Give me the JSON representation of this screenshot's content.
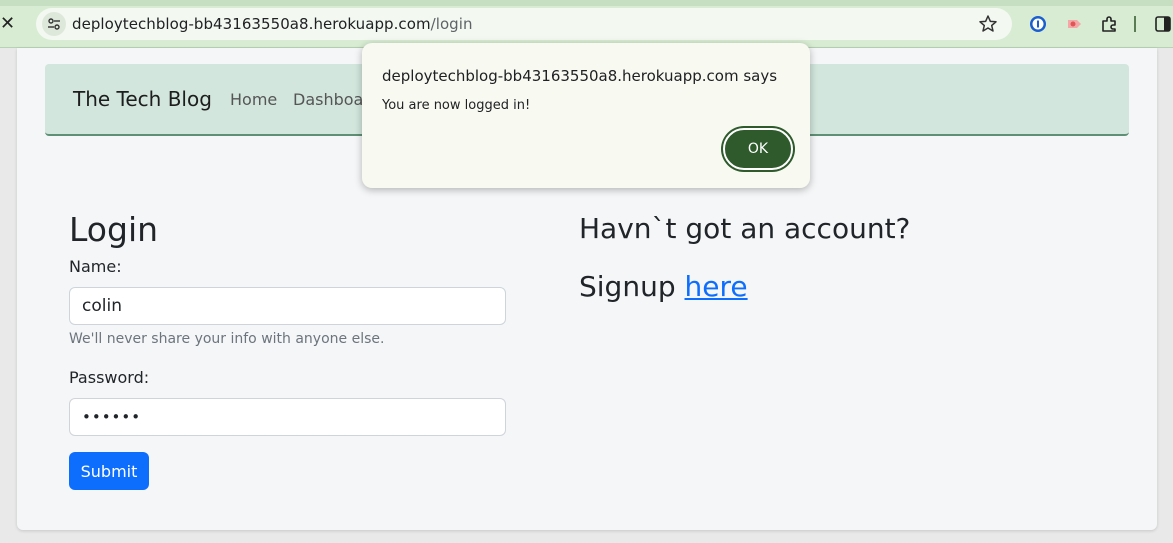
{
  "browser": {
    "url_host": "deploytechblog-bb43163550a8.herokuapp.com",
    "url_path": "/login",
    "icons": [
      "close-icon",
      "site-info-icon",
      "star-icon",
      "password-manager-icon",
      "extension-icon",
      "puzzle-icon",
      "sidebar-icon"
    ]
  },
  "navbar": {
    "brand": "The Tech Blog",
    "links": [
      "Home",
      "Dashboa"
    ]
  },
  "login": {
    "title": "Login",
    "name_label": "Name:",
    "name_value": "colin",
    "help_text": "We'll never share your info with anyone else.",
    "password_label": "Password:",
    "password_value": "••••••",
    "submit_label": "Submit"
  },
  "signup": {
    "heading": "Havn`t got an account?",
    "prompt": "Signup ",
    "link_text": "here"
  },
  "dialog": {
    "title": "deploytechblog-bb43163550a8.herokuapp.com says",
    "message": "You are now logged in!",
    "ok_label": "OK"
  },
  "colors": {
    "chrome": "#d7ecd2",
    "navbar": "#d2e6dd",
    "primary": "#0d6efd",
    "dialog_button": "#2e5a2c"
  }
}
